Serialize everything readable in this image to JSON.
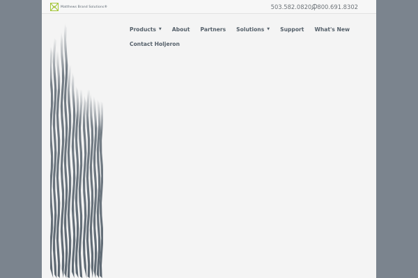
{
  "brand": {
    "logo_text": "Matthews Brand Solutions",
    "trademark": "®",
    "accent_color": "#a4c639",
    "text_color": "#5a6570"
  },
  "header": {
    "phone_numbers": "503.582.0820 | 800.691.8302",
    "search_icon": "search-icon"
  },
  "nav": {
    "items": [
      {
        "label": "Products",
        "has_dropdown": true
      },
      {
        "label": "About",
        "has_dropdown": false
      },
      {
        "label": "Partners",
        "has_dropdown": false
      },
      {
        "label": "Solutions",
        "has_dropdown": true
      },
      {
        "label": "Support",
        "has_dropdown": false
      },
      {
        "label": "What's New",
        "has_dropdown": false
      },
      {
        "label": "Contact Holjeron",
        "has_dropdown": false
      }
    ],
    "dropdown_icon": "caret-down-icon"
  },
  "colors": {
    "page_background": "#f4f4f4",
    "outer_background": "#7b848e",
    "hero_art": "#5d6872"
  }
}
